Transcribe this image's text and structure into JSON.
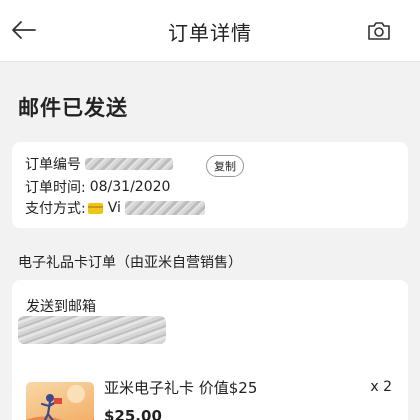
{
  "header": {
    "title": "订单详情",
    "back_icon": "arrow-left-icon",
    "camera_icon": "camera-icon"
  },
  "status": {
    "title": "邮件已发送"
  },
  "order_info": {
    "order_number_label": "订单编号",
    "copy_label": "复制",
    "order_time_label": "订单时间:",
    "order_time_value": "08/31/2020",
    "payment_label": "支付方式:",
    "payment_value": "Vi",
    "payment_icon": "card-icon"
  },
  "gift_section": {
    "heading": "电子礼品卡订单（由亚米自营销售）",
    "send_label": "发送到邮箱",
    "item": {
      "name": "亚米电子礼卡 价值$25",
      "quantity": "x 2",
      "price": "$25.00"
    }
  }
}
